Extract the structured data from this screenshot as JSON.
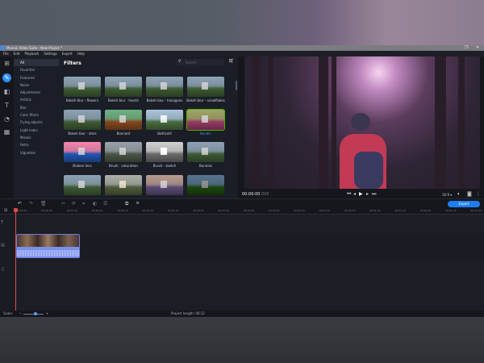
{
  "window": {
    "title": "Movavi Video Suite - New Project *",
    "maximize_icon": "restore-icon",
    "close_icon": "close-icon"
  },
  "menu": [
    "File",
    "Edit",
    "Playback",
    "Settings",
    "Export",
    "Help"
  ],
  "rail": [
    "import-icon",
    "filters-icon",
    "transitions-icon",
    "titles-icon",
    "stickers-icon",
    "more-tools-icon"
  ],
  "categories": [
    "All",
    "Favorites",
    "Featured",
    "Noise",
    "Adjustments",
    "Artistic",
    "Blur",
    "Color filters",
    "Flying objects",
    "Light leaks",
    "Mosaic",
    "Retro",
    "Vignettes"
  ],
  "filters": {
    "title": "Filters",
    "search_placeholder": "Search",
    "items": [
      {
        "label": "Bokeh blur - flowers"
      },
      {
        "label": "Bokeh blur - hearts"
      },
      {
        "label": "Bokeh blur - hexagons"
      },
      {
        "label": "Bokeh blur - snowflakes"
      },
      {
        "label": "Bokeh blur - stars"
      },
      {
        "label": "Bonnard"
      },
      {
        "label": "Botticelli"
      },
      {
        "label": "Boudin",
        "selected": true
      },
      {
        "label": "Broken lens"
      },
      {
        "label": "Brush - saturation"
      },
      {
        "label": "Brush - sketch"
      },
      {
        "label": "Bunnies"
      },
      {
        "label": ""
      },
      {
        "label": ""
      },
      {
        "label": ""
      },
      {
        "label": ""
      }
    ]
  },
  "player": {
    "timecode": "00:00:00",
    "timecode_ms": ".000",
    "aspect": "16:9 ▾"
  },
  "timeline": {
    "export_label": "Export",
    "ruler": [
      "00:00:00",
      "00:00:05",
      "00:00:10",
      "00:00:15",
      "00:00:20",
      "00:00:25",
      "00:00:30",
      "00:00:35",
      "00:00:40",
      "00:00:45",
      "00:00:50",
      "00:00:55",
      "00:01:00",
      "00:01:05",
      "00:01:10",
      "00:01:15",
      "00:01:20",
      "00:01:25",
      "00:01:30"
    ],
    "scale_label": "Scale:",
    "project_length": "Project length: 00:12"
  },
  "colors": {
    "accent": "#2f8cff",
    "playhead": "#e04848"
  }
}
